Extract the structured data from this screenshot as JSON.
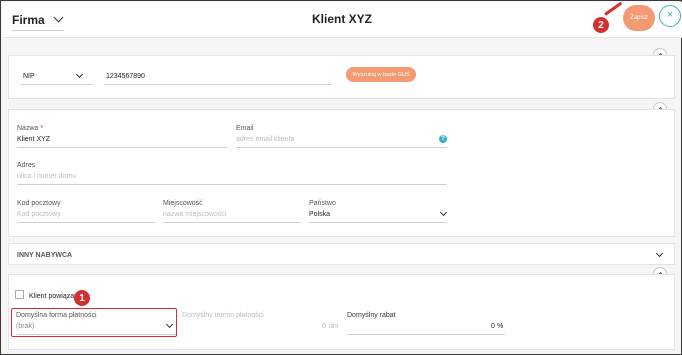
{
  "header": {
    "type_select": "Firma",
    "title": "Klient XYZ",
    "save_label": "Zapisz",
    "close_label": "×"
  },
  "markers": {
    "m1": "1",
    "m2": "2"
  },
  "tax": {
    "id_type": "NIP",
    "id_value": "1234567890",
    "gus_button": "Wyszukaj w bazie GUS"
  },
  "details": {
    "name_label": "Nazwa",
    "name_required": "*",
    "name_value": "Klient XYZ",
    "email_label": "Email",
    "email_placeholder": "adres email klienta",
    "help_icon": "?",
    "address_label": "Adres",
    "address_placeholder": "ulica i numer domu",
    "postal_label": "Kod pocztowy",
    "postal_placeholder": "Kod pocztowy",
    "city_label": "Miejscowość",
    "city_placeholder": "nazwa miejscowości",
    "country_label": "Państwo",
    "country_value": "Polska"
  },
  "other_buyer": {
    "title": "INNY NABYWCA"
  },
  "payment": {
    "related_client_label": "Klient powiązany",
    "payment_method_label": "Domyślna forma płatności",
    "payment_method_value": "(brak)",
    "payment_term_label": "Domyślny termin płatności",
    "payment_term_value": "0",
    "payment_term_unit": "dni",
    "discount_label": "Domyślny rabat",
    "discount_value": "0",
    "discount_unit": "%"
  },
  "colors": {
    "accent": "#f39a72",
    "close": "#3ab0c9",
    "marker": "#d32f2f"
  }
}
